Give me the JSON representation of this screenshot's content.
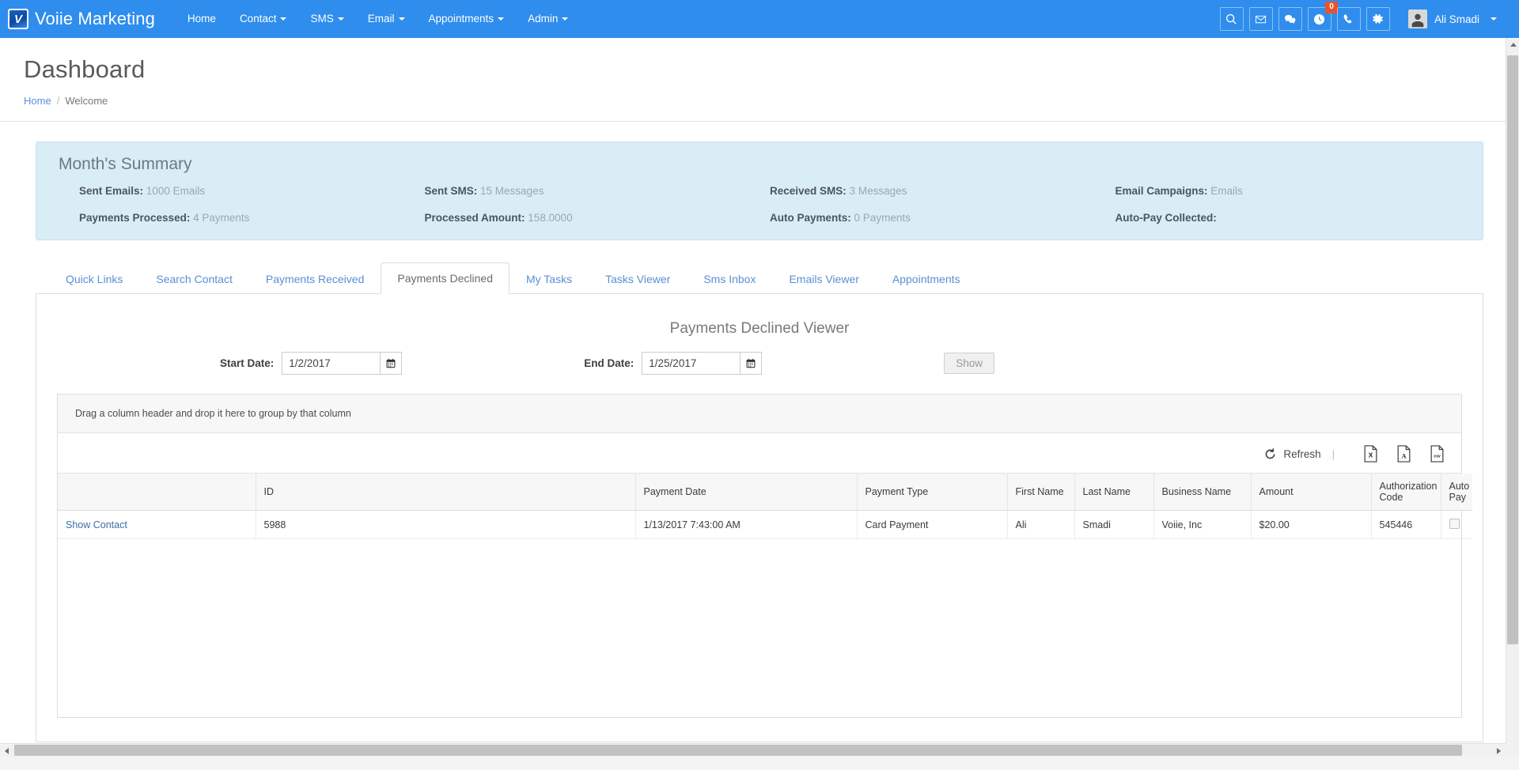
{
  "brand": {
    "logo_letter": "V",
    "name": "Voiie Marketing"
  },
  "nav": {
    "items": [
      {
        "label": "Home",
        "caret": false
      },
      {
        "label": "Contact",
        "caret": true
      },
      {
        "label": "SMS",
        "caret": true
      },
      {
        "label": "Email",
        "caret": true
      },
      {
        "label": "Appointments",
        "caret": true
      },
      {
        "label": "Admin",
        "caret": true
      }
    ],
    "icons": [
      {
        "name": "search-icon",
        "badge": ""
      },
      {
        "name": "envelope-icon",
        "badge": ""
      },
      {
        "name": "comments-icon",
        "badge": ""
      },
      {
        "name": "clock-icon",
        "badge": "0"
      },
      {
        "name": "phone-icon",
        "badge": ""
      },
      {
        "name": "gear-icon",
        "badge": ""
      }
    ],
    "user": "Ali Smadi"
  },
  "page": {
    "title": "Dashboard",
    "breadcrumb": {
      "home": "Home",
      "separator": "/",
      "current": "Welcome"
    }
  },
  "summary": {
    "title": "Month's Summary",
    "stats": [
      {
        "label": "Sent Emails:",
        "value": "1000 Emails"
      },
      {
        "label": "Sent SMS:",
        "value": "15 Messages"
      },
      {
        "label": "Received SMS:",
        "value": "3 Messages"
      },
      {
        "label": "Email Campaigns:",
        "value": "Emails"
      },
      {
        "label": "Payments Processed:",
        "value": "4 Payments"
      },
      {
        "label": "Processed Amount:",
        "value": "158.0000"
      },
      {
        "label": "Auto Payments:",
        "value": "0 Payments"
      },
      {
        "label": "Auto-Pay Collected:",
        "value": ""
      }
    ]
  },
  "tabs": [
    {
      "label": "Quick Links",
      "active": false
    },
    {
      "label": "Search Contact",
      "active": false
    },
    {
      "label": "Payments Received",
      "active": false
    },
    {
      "label": "Payments Declined",
      "active": true
    },
    {
      "label": "My Tasks",
      "active": false
    },
    {
      "label": "Tasks Viewer",
      "active": false
    },
    {
      "label": "Sms Inbox",
      "active": false
    },
    {
      "label": "Emails Viewer",
      "active": false
    },
    {
      "label": "Appointments",
      "active": false
    }
  ],
  "viewer": {
    "title": "Payments Declined Viewer",
    "start_date_label": "Start Date:",
    "start_date_value": "1/2/2017",
    "end_date_label": "End Date:",
    "end_date_value": "1/25/2017",
    "show_button": "Show"
  },
  "grid": {
    "group_hint": "Drag a column header and drop it here to group by that column",
    "toolbar": {
      "refresh": "Refresh",
      "separator": "|",
      "export_excel": "excel-export-icon",
      "export_pdf": "pdf-export-icon",
      "export_csv": "csv-export-icon"
    },
    "columns": [
      "",
      "ID",
      "Payment Date",
      "Payment Type",
      "First Name",
      "Last Name",
      "Business Name",
      "Amount",
      "Authorization Code",
      "Auto Pay"
    ],
    "rows": [
      {
        "action": "Show Contact",
        "id": "5988",
        "payment_date": "1/13/2017 7:43:00 AM",
        "payment_type": "Card Payment",
        "first_name": "Ali",
        "last_name": "Smadi",
        "business_name": "Voiie, Inc",
        "amount": "$20.00",
        "auth_code": "545446",
        "auto_pay": false
      }
    ]
  },
  "colors": {
    "navbar": "#2f8ded",
    "panel": "#d9edf7",
    "link": "#5a8fd6",
    "badge": "#e8522b"
  }
}
